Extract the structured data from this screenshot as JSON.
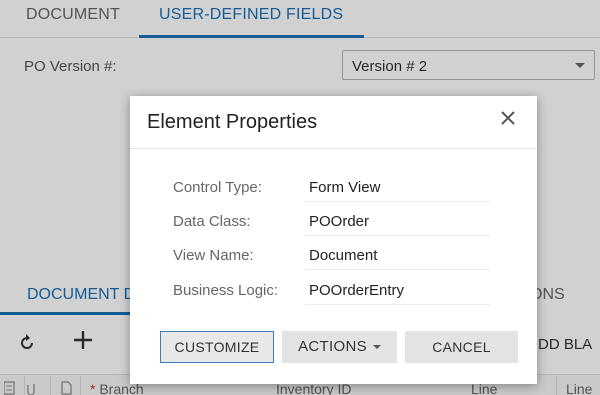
{
  "tabs": {
    "document": "DOCUMENT",
    "user_defined_fields": "USER-DEFINED FIELDS"
  },
  "po_version": {
    "label": "PO Version #:",
    "value": "Version # 2"
  },
  "bottom_tabs": {
    "first": "DOCUMENT D",
    "right": "ONS"
  },
  "toolbar": {
    "refresh_icon": "refresh-icon",
    "add_icon": "plus-icon",
    "add_blank": "DD BLA"
  },
  "grid_header": {
    "branch_required": "*",
    "branch": "Branch",
    "inventory_id": "Inventory ID",
    "line": "Line",
    "line2": "Line"
  },
  "dialog": {
    "title": "Element Properties",
    "close_icon": "close-icon",
    "properties": [
      {
        "label": "Control Type:",
        "value": "Form View"
      },
      {
        "label": "Data Class:",
        "value": "POOrder"
      },
      {
        "label": "View Name:",
        "value": "Document"
      },
      {
        "label": "Business Logic:",
        "value": "POOrderEntry"
      }
    ],
    "buttons": {
      "customize": "CUSTOMIZE",
      "actions": "ACTIONS",
      "cancel": "CANCEL"
    }
  }
}
